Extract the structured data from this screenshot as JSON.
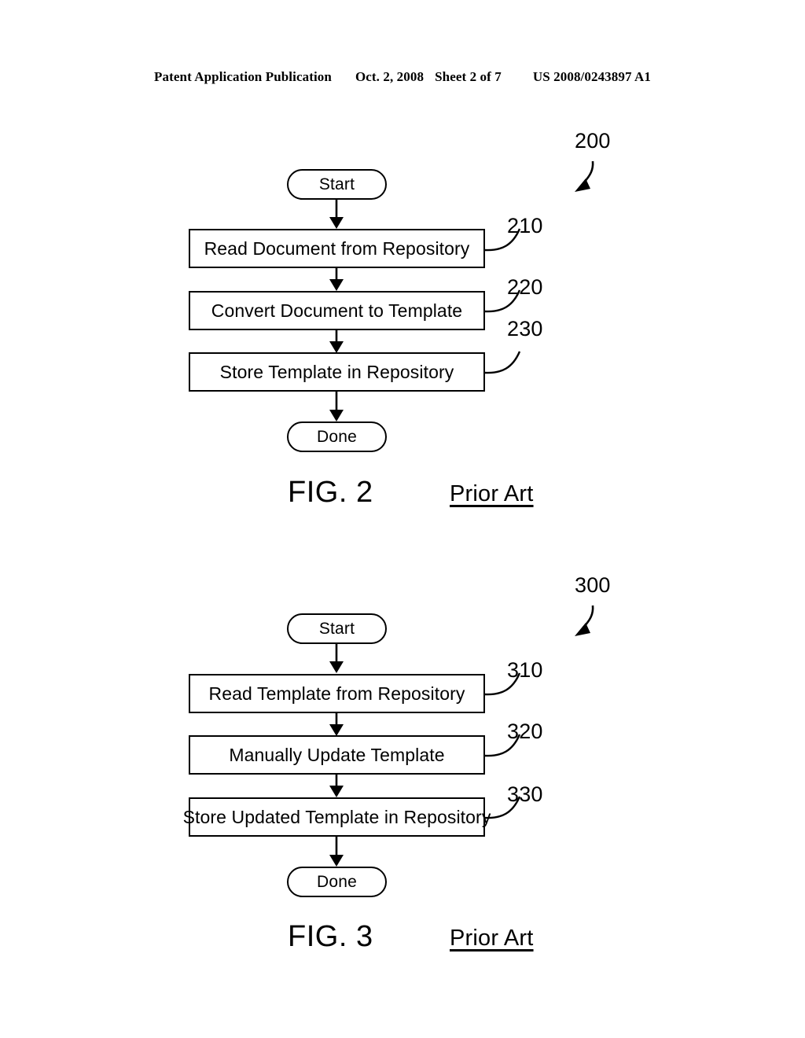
{
  "header": {
    "publication": "Patent Application Publication",
    "date": "Oct. 2, 2008",
    "sheet": "Sheet 2 of 7",
    "patent_number": "US 2008/0243897 A1"
  },
  "colors": {
    "ink": "#000000",
    "paper": "#ffffff"
  },
  "figures": [
    {
      "id": "figure-200",
      "figure_label": "FIG. 2",
      "prior_art_label": "Prior Art",
      "figure_ref": "200",
      "start_label": "Start",
      "done_label": "Done",
      "steps": [
        {
          "ref": "210",
          "label": "Read Document from Repository"
        },
        {
          "ref": "220",
          "label": "Convert Document to Template"
        },
        {
          "ref": "230",
          "label": "Store Template in Repository"
        }
      ]
    },
    {
      "id": "figure-300",
      "figure_label": "FIG. 3",
      "prior_art_label": "Prior Art",
      "figure_ref": "300",
      "start_label": "Start",
      "done_label": "Done",
      "steps": [
        {
          "ref": "310",
          "label": "Read Template from Repository"
        },
        {
          "ref": "320",
          "label": "Manually Update Template"
        },
        {
          "ref": "330",
          "label": "Store Updated Template in Repository"
        }
      ]
    }
  ]
}
